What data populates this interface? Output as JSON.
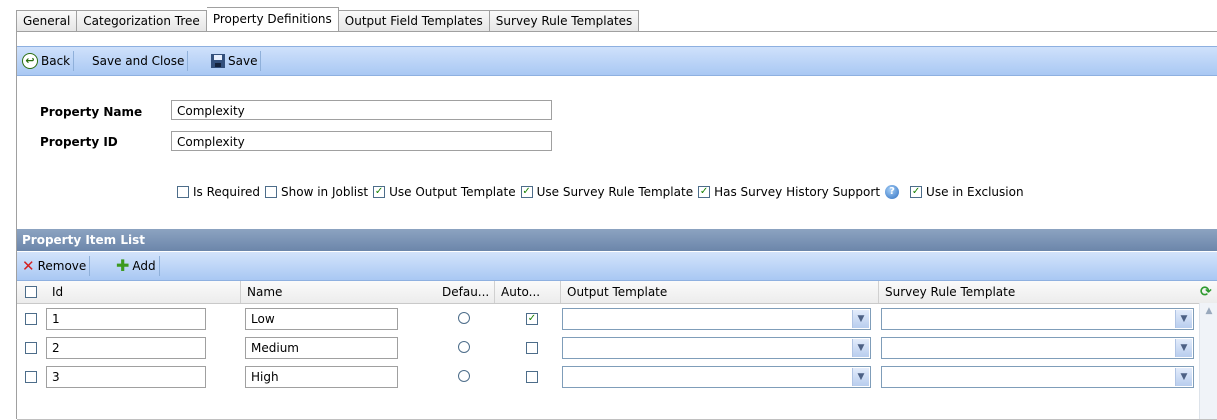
{
  "tabs": [
    "General",
    "Categorization Tree",
    "Property Definitions",
    "Output Field Templates",
    "Survey Rule Templates"
  ],
  "toolbar": {
    "back": "Back",
    "save_close": "Save and Close",
    "save": "Save"
  },
  "form": {
    "name_label": "Property Name",
    "name_value": "Complexity",
    "id_label": "Property ID",
    "id_value": "Complexity"
  },
  "options": [
    {
      "label": "Is Required",
      "checked": false
    },
    {
      "label": "Show in Joblist",
      "checked": false
    },
    {
      "label": "Use Output Template",
      "checked": true
    },
    {
      "label": "Use Survey Rule Template",
      "checked": true
    },
    {
      "label": "Has Survey History Support",
      "checked": true
    },
    {
      "label": "Use in Exclusion",
      "checked": true
    }
  ],
  "list": {
    "title": "Property Item List",
    "remove": "Remove",
    "add": "Add",
    "columns": {
      "id": "Id",
      "name": "Name",
      "default": "Defau...",
      "auto": "Auto...",
      "output": "Output Template",
      "survey": "Survey Rule Template"
    },
    "rows": [
      {
        "id": "1",
        "name": "Low",
        "auto": true
      },
      {
        "id": "2",
        "name": "Medium",
        "auto": false
      },
      {
        "id": "3",
        "name": "High",
        "auto": false
      }
    ]
  }
}
